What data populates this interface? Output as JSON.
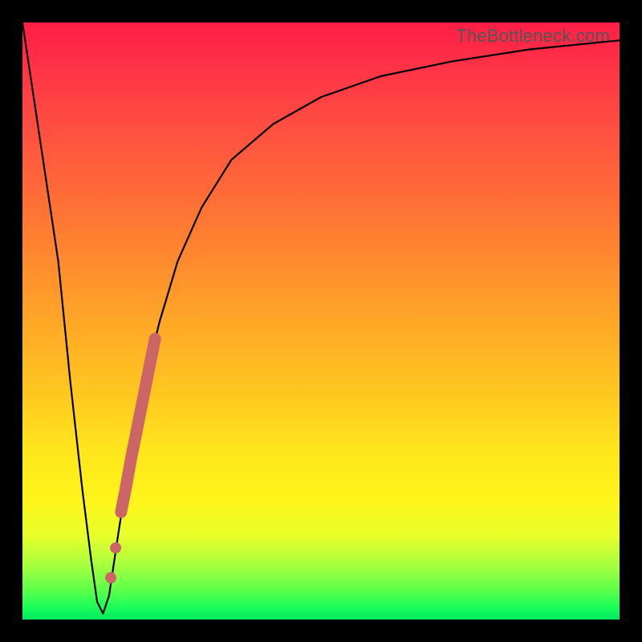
{
  "watermark": "TheBottleneck.com",
  "chart_data": {
    "type": "line",
    "title": "",
    "xlabel": "",
    "ylabel": "",
    "xlim": [
      0,
      100
    ],
    "ylim": [
      0,
      100
    ],
    "series": [
      {
        "name": "bottleneck-curve",
        "x": [
          0,
          3,
          6,
          8,
          10,
          11.5,
          12.5,
          13.5,
          14.5,
          16,
          18,
          20,
          23,
          26,
          30,
          35,
          42,
          50,
          60,
          72,
          85,
          100
        ],
        "values": [
          100,
          80,
          60,
          40,
          22,
          10,
          3,
          1,
          4,
          14,
          27,
          38,
          50,
          60,
          69,
          77,
          83,
          87.5,
          91,
          93.5,
          95.5,
          97
        ]
      },
      {
        "name": "highlight-segment",
        "x": [
          16.5,
          17.3,
          18.2,
          19.0,
          19.8,
          20.6,
          21.4,
          22.2
        ],
        "values": [
          18,
          22,
          27,
          31,
          35,
          39,
          43,
          47
        ]
      },
      {
        "name": "highlight-dots",
        "x": [
          14.8,
          15.6
        ],
        "values": [
          7,
          12
        ]
      }
    ],
    "colors": {
      "curve": "#000000",
      "highlight": "#CC6666"
    }
  }
}
